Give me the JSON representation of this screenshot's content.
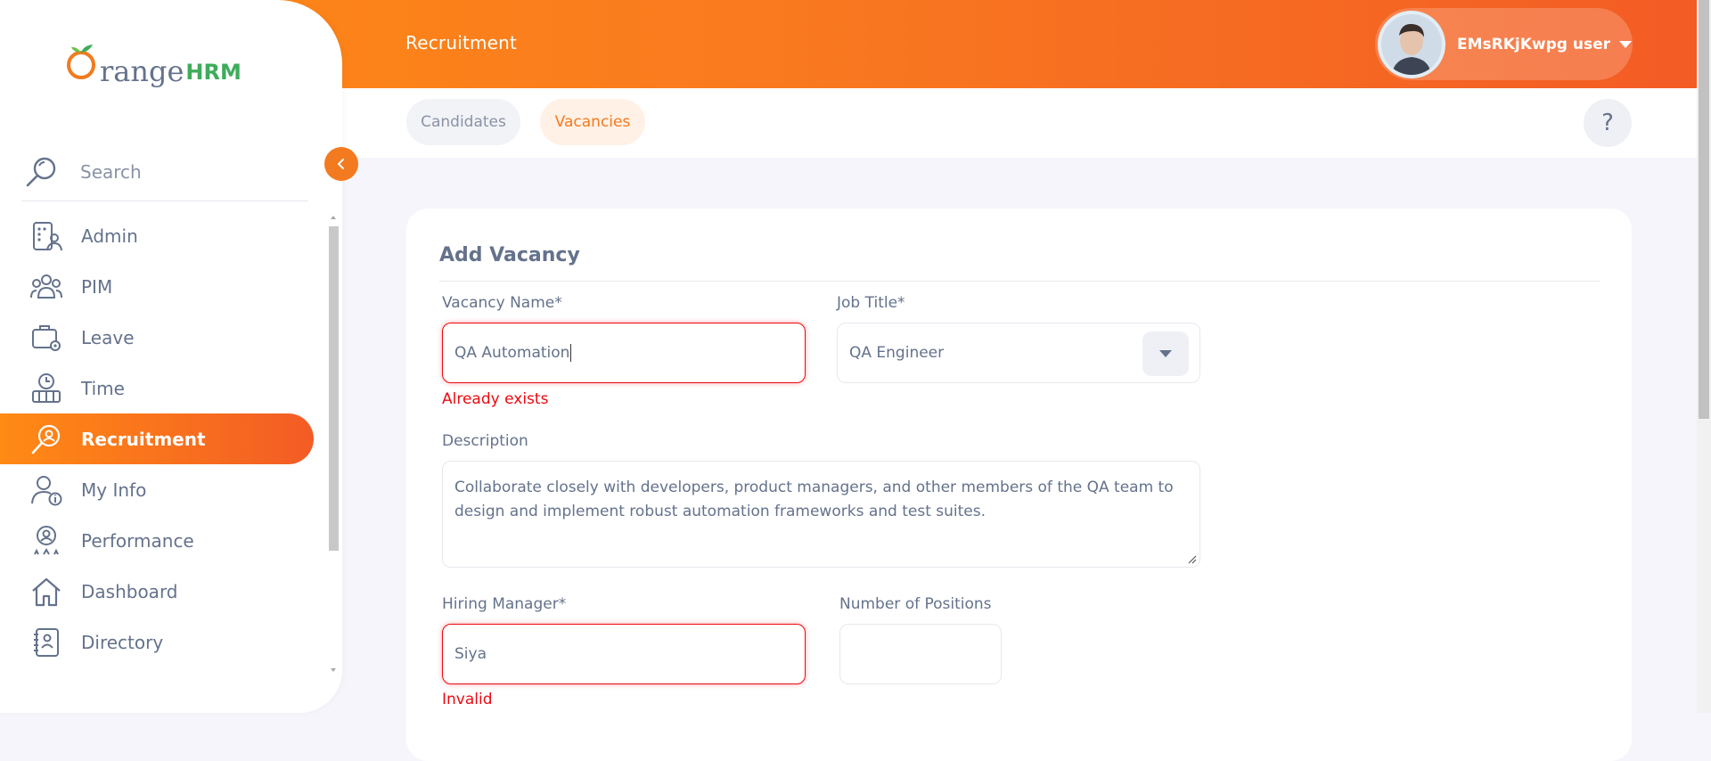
{
  "brand": {
    "name_o": "O",
    "name_rest": "range",
    "name_hrm": "HRM"
  },
  "header": {
    "module_title": "Recruitment",
    "user_name": "EMsRKjKwpg user"
  },
  "subnav": {
    "tabs": [
      {
        "label": "Candidates"
      },
      {
        "label": "Vacancies"
      }
    ],
    "help_label": "?"
  },
  "sidebar": {
    "search_label": "Search",
    "items": [
      {
        "label": "Admin",
        "icon": "admin-icon"
      },
      {
        "label": "PIM",
        "icon": "pim-icon"
      },
      {
        "label": "Leave",
        "icon": "leave-icon"
      },
      {
        "label": "Time",
        "icon": "time-icon"
      },
      {
        "label": "Recruitment",
        "icon": "recruitment-icon",
        "active": true
      },
      {
        "label": "My Info",
        "icon": "my-info-icon"
      },
      {
        "label": "Performance",
        "icon": "performance-icon"
      },
      {
        "label": "Dashboard",
        "icon": "dashboard-icon"
      },
      {
        "label": "Directory",
        "icon": "directory-icon"
      }
    ]
  },
  "form": {
    "title": "Add Vacancy",
    "vacancy_name": {
      "label": "Vacancy Name*",
      "value": "QA Automation",
      "error": "Already exists"
    },
    "job_title": {
      "label": "Job Title*",
      "value": "QA Engineer"
    },
    "description": {
      "label": "Description",
      "value": "Collaborate closely with developers, product managers, and other members of the QA team to design and implement robust automation frameworks and test suites."
    },
    "hiring_manager": {
      "label": "Hiring Manager*",
      "value": "Siya",
      "error": "Invalid"
    },
    "number_of_positions": {
      "label": "Number of Positions",
      "value": ""
    }
  },
  "colors": {
    "accent": "#f37a1f",
    "error": "#eb0910",
    "text": "#64728c",
    "hrm_green": "#3eac5a"
  }
}
